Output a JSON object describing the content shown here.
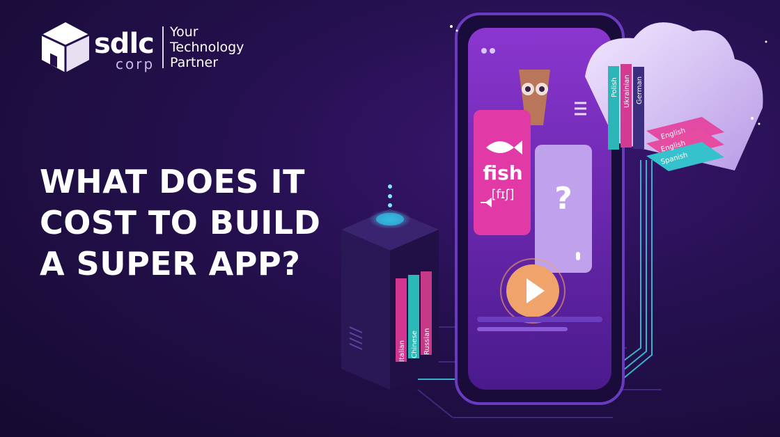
{
  "brand": {
    "wordmark": "sdlc",
    "sub": "corp",
    "tagline": [
      "Your",
      "Technology",
      "Partner"
    ]
  },
  "headline": [
    "WHAT DOES IT",
    "COST TO BUILD",
    "A SUPER APP?"
  ],
  "phone": {
    "card_word": "fish",
    "card_phonetic": "[fɪʃ]",
    "card_question": "?"
  },
  "books": {
    "tower": [
      "Italian",
      "Chinese",
      "Russian"
    ],
    "cloud_vertical": [
      "Polish",
      "Ukrainian",
      "German"
    ],
    "cloud_stack": [
      "English",
      "English",
      "Spanish"
    ]
  },
  "colors": {
    "background": "#24104d",
    "accent_pink": "#e13aa6",
    "accent_teal": "#33c6cf",
    "phone_screen": "#7e2ec7",
    "play_orange": "#f0a36a"
  }
}
